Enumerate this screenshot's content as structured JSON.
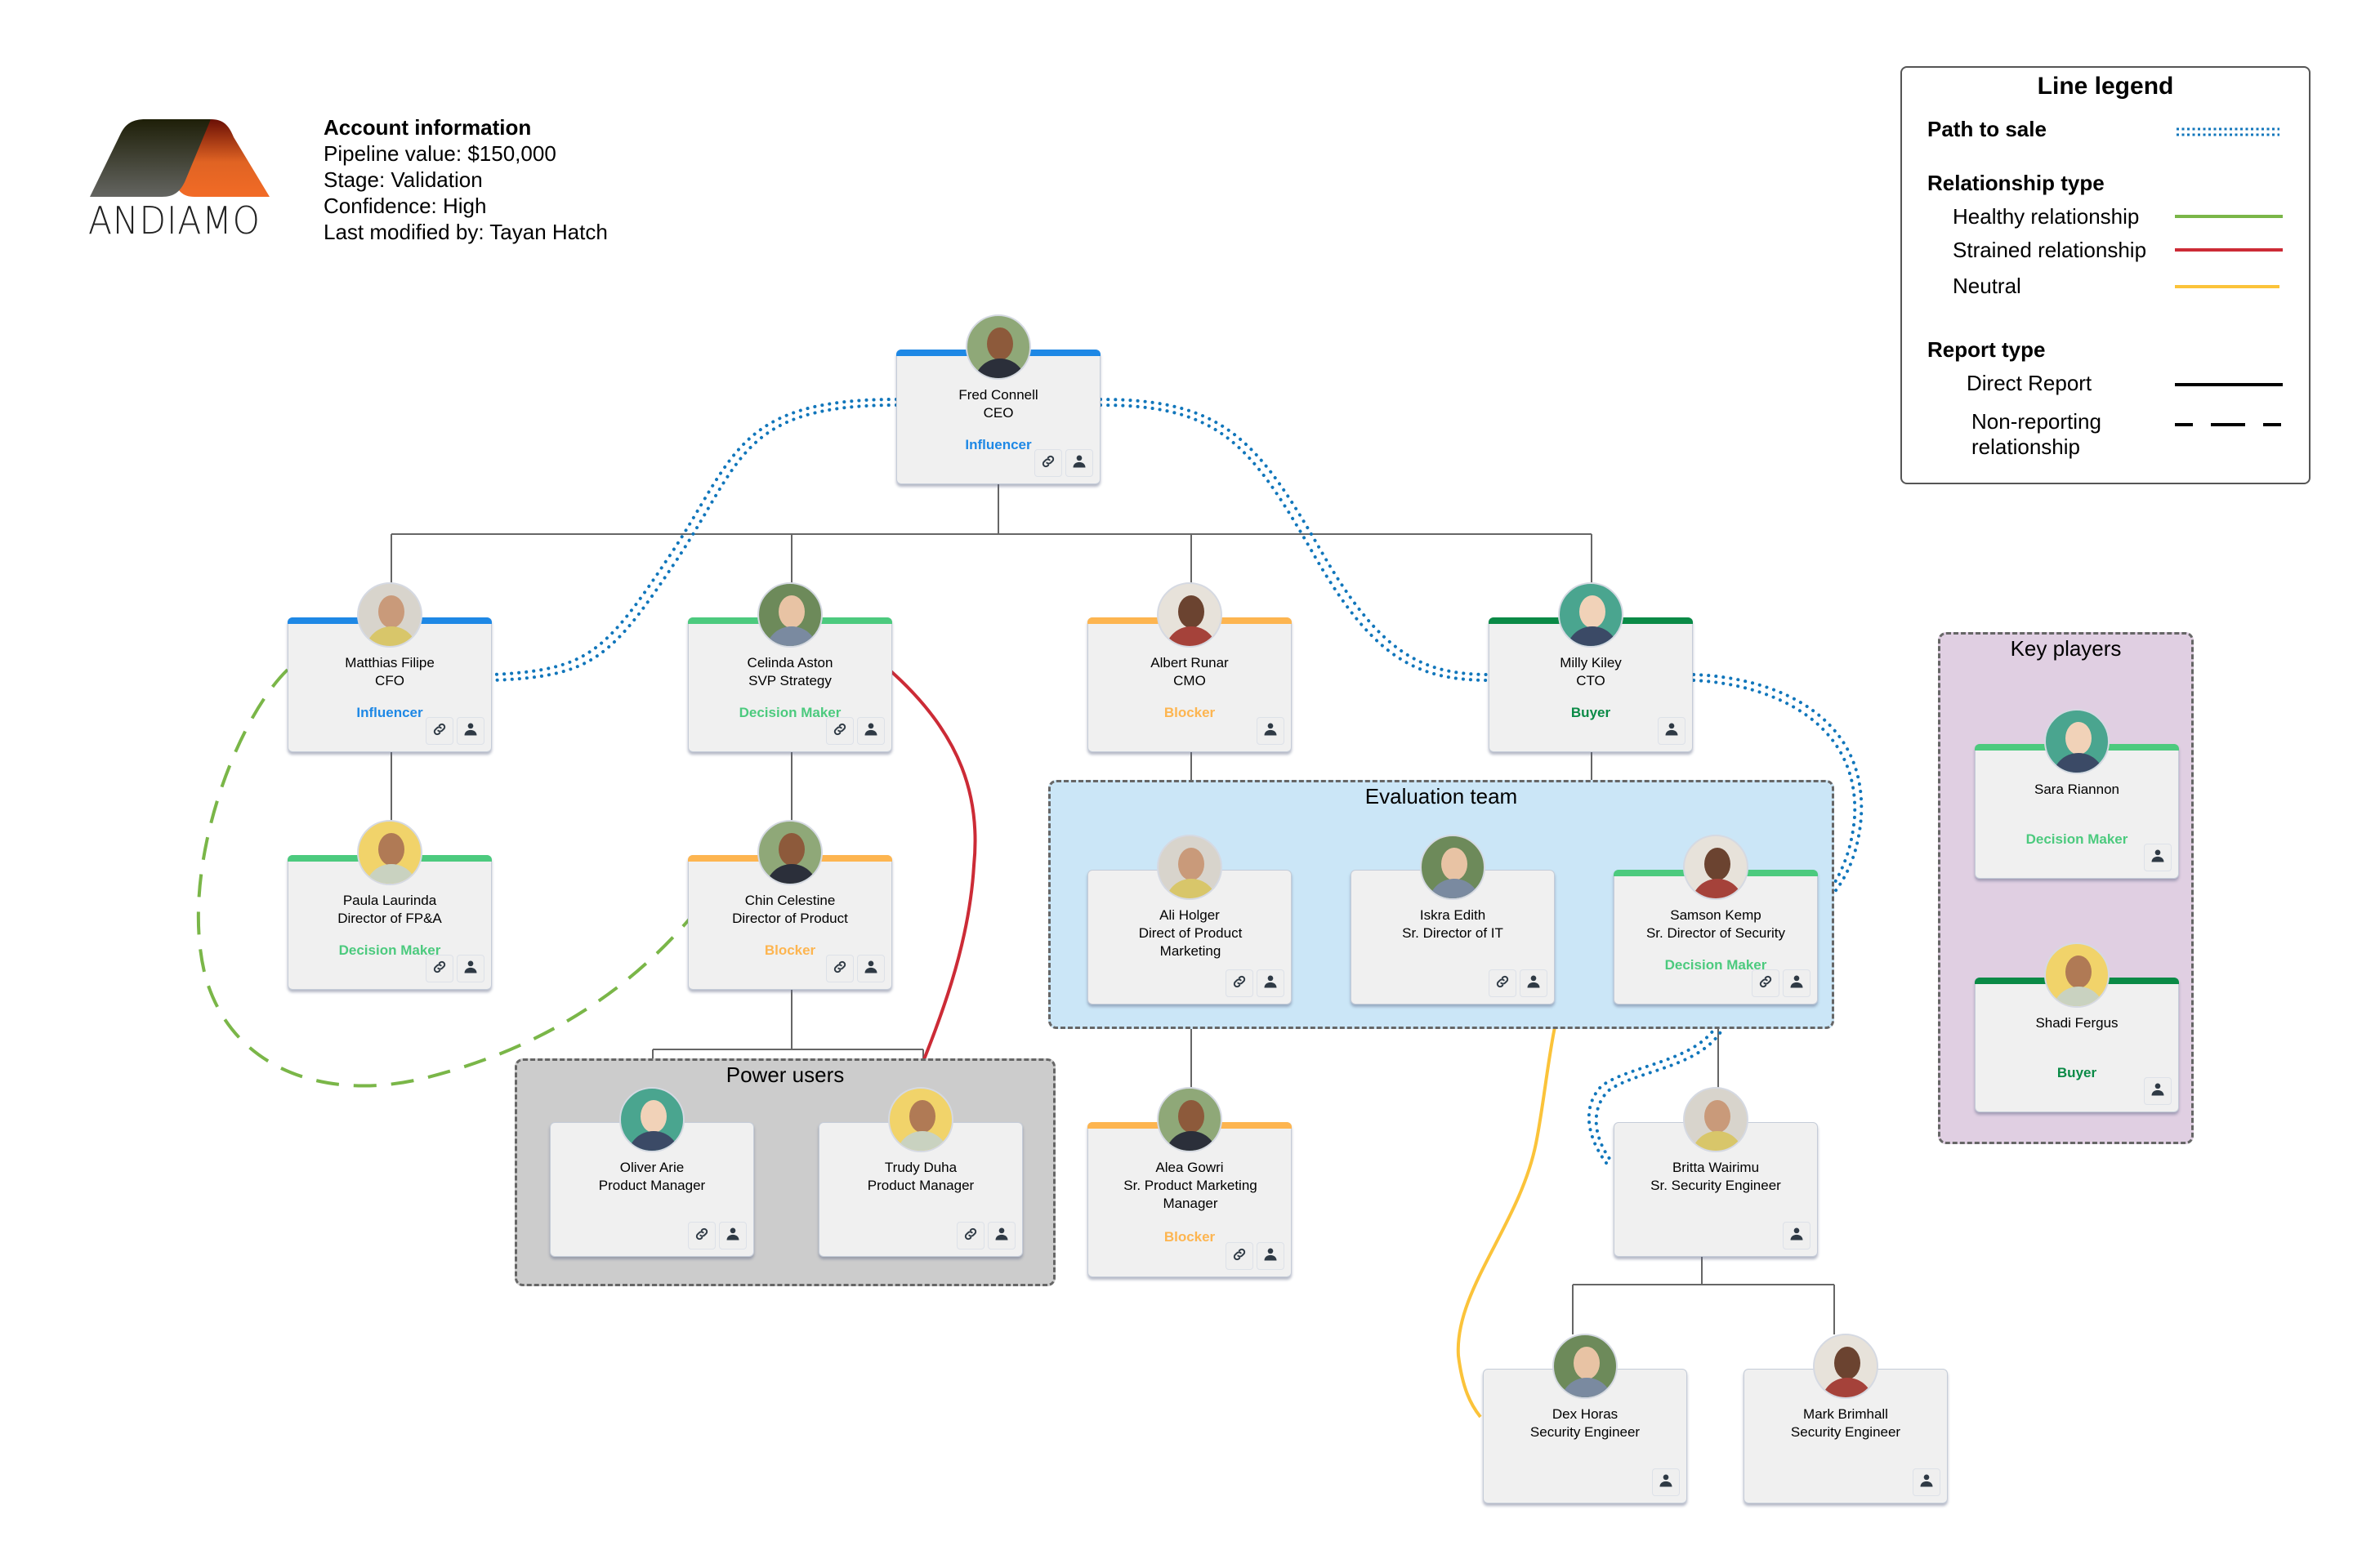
{
  "logo": {
    "text": "ANDIAMO",
    "icon": "andiamo-logo-icon"
  },
  "account": {
    "heading": "Account information",
    "lines": [
      "Pipeline value: $150,000",
      "Stage: Validation",
      "Confidence: High",
      "Last modified by: Tayan Hatch"
    ]
  },
  "legend": {
    "title": "Line legend",
    "path_to_sale": "Path to sale",
    "relationship_type": "Relationship type",
    "healthy": "Healthy relationship",
    "strained": "Strained relationship",
    "neutral": "Neutral",
    "report_type": "Report type",
    "direct": "Direct Report",
    "non_reporting_1": "Non-reporting",
    "non_reporting_2": "relationship"
  },
  "colors": {
    "influencer": "#1e88e5",
    "decision_maker": "#4cca7e",
    "blocker": "#fdb550",
    "buyer": "#0a8a46",
    "path_to_sale": "#1176bb",
    "healthy": "#7ab648",
    "strained": "#cc2b36",
    "neutral": "#fbc33a",
    "connector": "#666666"
  },
  "groups": {
    "evaluation": "Evaluation team",
    "power_users": "Power users",
    "key_players": "Key players"
  },
  "people": {
    "fred": {
      "name": "Fred Connell",
      "title": "CEO",
      "tag": "Influencer",
      "tagtype": "influencer",
      "link": true
    },
    "matthias": {
      "name": "Matthias Filipe",
      "title": "CFO",
      "tag": "Influencer",
      "tagtype": "influencer",
      "link": true
    },
    "celinda": {
      "name": "Celinda Aston",
      "title": "SVP Strategy",
      "tag": "Decision Maker",
      "tagtype": "decision_maker",
      "link": true
    },
    "albert": {
      "name": "Albert Runar",
      "title": "CMO",
      "tag": "Blocker",
      "tagtype": "blocker",
      "link": false
    },
    "milly": {
      "name": "Milly Kiley",
      "title": "CTO",
      "tag": "Buyer",
      "tagtype": "buyer",
      "link": false
    },
    "paula": {
      "name": "Paula Laurinda",
      "title": "Director of FP&A",
      "tag": "Decision Maker",
      "tagtype": "decision_maker",
      "link": true
    },
    "chin": {
      "name": "Chin Celestine",
      "title": "Director of Product",
      "tag": "Blocker",
      "tagtype": "blocker",
      "link": true
    },
    "ali": {
      "name": "Ali Holger",
      "title": "Direct of Product Marketing",
      "tag": "",
      "tagtype": "",
      "link": true
    },
    "iskra": {
      "name": "Iskra Edith",
      "title": "Sr. Director of IT",
      "tag": "",
      "tagtype": "",
      "link": true
    },
    "samson": {
      "name": "Samson Kemp",
      "title": "Sr. Director of Security",
      "tag": "Decision Maker",
      "tagtype": "decision_maker",
      "link": true
    },
    "oliver": {
      "name": "Oliver Arie",
      "title": "Product Manager",
      "tag": "",
      "tagtype": "",
      "link": true
    },
    "trudy": {
      "name": "Trudy Duha",
      "title": "Product Manager",
      "tag": "",
      "tagtype": "",
      "link": true
    },
    "alea": {
      "name": "Alea Gowri",
      "title": "Sr. Product Marketing Manager",
      "tag": "Blocker",
      "tagtype": "blocker",
      "link": true
    },
    "britta": {
      "name": "Britta Wairimu",
      "title": "Sr. Security Engineer",
      "tag": "",
      "tagtype": "",
      "link": false
    },
    "dex": {
      "name": "Dex Horas",
      "title": "Security Engineer",
      "tag": "",
      "tagtype": "",
      "link": false
    },
    "mark": {
      "name": "Mark Brimhall",
      "title": "Security Engineer",
      "tag": "",
      "tagtype": "",
      "link": false
    },
    "sara": {
      "name": "Sara Riannon",
      "title": "",
      "tag": "Decision Maker",
      "tagtype": "decision_maker",
      "link": false
    },
    "shadi": {
      "name": "Shadi Fergus",
      "title": "",
      "tag": "Buyer",
      "tagtype": "buyer",
      "link": false
    }
  }
}
